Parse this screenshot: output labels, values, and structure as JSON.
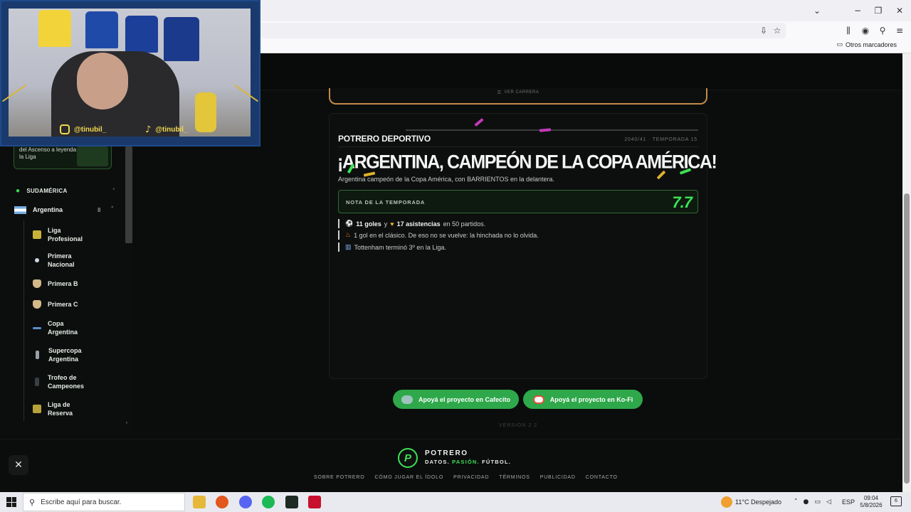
{
  "browser": {
    "bookmarks_label": "Otros marcadores",
    "window_controls": [
      "chevron-down-icon",
      "minimize-icon",
      "restore-icon",
      "close-icon"
    ]
  },
  "stream_overlay": {
    "instagram_handle": "@tinubil_",
    "tiktok_handle": "@tinubil_"
  },
  "sidebar": {
    "promo_text": "del Ascenso a leyenda de la Liga",
    "section_label": "SUDAMÉRICA",
    "country": {
      "name": "Argentina",
      "count": "8"
    },
    "items": [
      {
        "label": "Liga Profesional",
        "color": "#c9b23a"
      },
      {
        "label": "Primera Nacional",
        "color": "#cfd6e0"
      },
      {
        "label": "Primera B",
        "color": "#d4b98a"
      },
      {
        "label": "Primera C",
        "color": "#d4b98a"
      },
      {
        "label": "Copa Argentina",
        "color": "#5a8fd0"
      },
      {
        "label": "Supercopa Argentina",
        "color": "#9aa0a8"
      },
      {
        "label": "Trofeo de Campeones",
        "color": "#7a7f85"
      },
      {
        "label": "Liga de Reserva",
        "color": "#b7a13a"
      }
    ]
  },
  "career": {
    "ver_carrera": "VER CARRERA"
  },
  "season_card": {
    "brand": "POTRERO DEPORTIVO",
    "season": "2040/41 · TEMPORADA 15",
    "headline": "¡ARGENTINA, CAMPEÓN DE LA COPA AMÉRICA!",
    "subline": "Argentina campeón de la Copa América, con BARRIENTOS en la delantera.",
    "rating_label": "NOTA DE LA TEMPORADA",
    "rating_value": "7.7",
    "stats": {
      "goals": "11 goles",
      "joiner": "y",
      "assists": "17 asistencias",
      "matches": "en 50 partidos.",
      "clasico": "1 gol en el clásico. De eso no se vuelve: la hinchada no lo olvida.",
      "league": "Tottenham terminó 3º en la Liga."
    }
  },
  "support": {
    "cafecito": "Apoyá el proyecto en Cafecito",
    "kofi": "Apoyá el proyecto en Ko-Fi"
  },
  "version": "VERSIÓN 2.2",
  "footer": {
    "brand": "POTRERO",
    "tag_1": "DATOS.",
    "tag_2": "PASIÓN.",
    "tag_3": "FÚTBOL.",
    "links": [
      "SOBRE POTRERO",
      "CÓMO JUGAR EL ÍDOLO",
      "PRIVACIDAD",
      "TÉRMINOS",
      "PUBLICIDAD",
      "CONTACTO"
    ]
  },
  "taskbar": {
    "search_placeholder": "Escribe aquí para buscar.",
    "weather": "11°C  Despejado",
    "language": "ESP",
    "time": "09:04",
    "date": "5/8/2026",
    "notifications": "6"
  },
  "colors": {
    "accent_green": "#3be154",
    "button_green": "#2ea84a",
    "career_border": "#c58a4a"
  }
}
